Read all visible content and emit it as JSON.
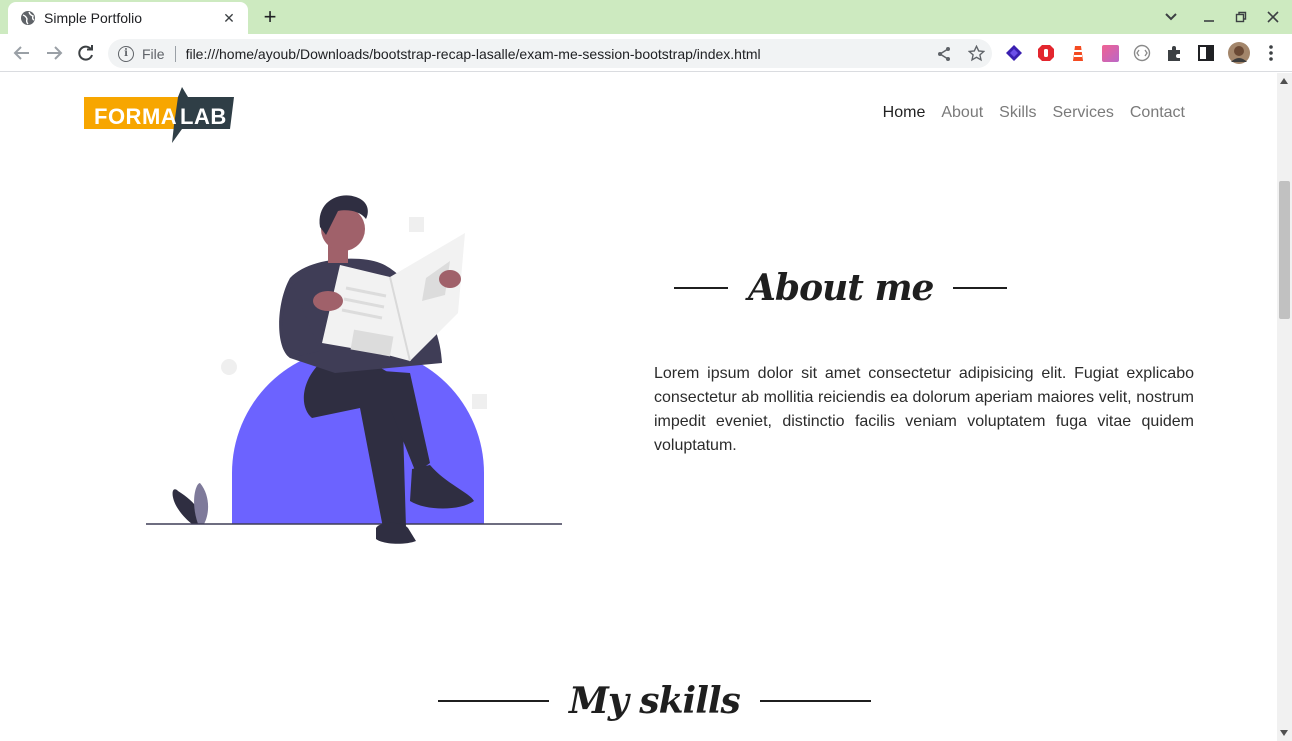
{
  "browser": {
    "tab_title": "Simple Portfolio",
    "new_tab_label": "+",
    "address_scheme": "File",
    "address_url": "file:///home/ayoub/Downloads/bootstrap-recap-lasalle/exam-me-session-bootstrap/index.html"
  },
  "site": {
    "logo_part1": "FORMA",
    "logo_part2": "LAB",
    "nav": [
      {
        "label": "Home",
        "active": true
      },
      {
        "label": "About",
        "active": false
      },
      {
        "label": "Skills",
        "active": false
      },
      {
        "label": "Services",
        "active": false
      },
      {
        "label": "Contact",
        "active": false
      }
    ]
  },
  "about": {
    "title": "About me",
    "text": "Lorem ipsum dolor sit amet consectetur adipisicing elit. Fugiat explicabo consectetur ab mollitia reiciendis ea dolorum aperiam maiores velit, nostrum impedit eveniet, distinctio facilis veniam voluptatem fuga vitae quidem voluptatum."
  },
  "skills": {
    "title": "My skills"
  },
  "colors": {
    "tab_bar": "#cdeac0",
    "logo_yellow": "#f7a600",
    "logo_dark": "#2f3e46",
    "illustration_purple": "#6c63ff",
    "person_dark": "#2f2e41",
    "skin": "#a0616a"
  }
}
